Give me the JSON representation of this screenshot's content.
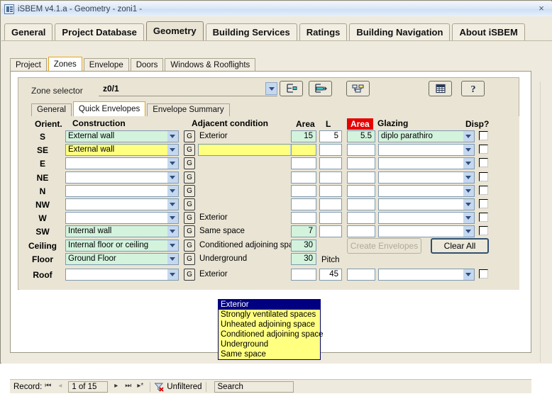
{
  "window": {
    "title": "iSBEM v4.1.a - Geometry - zoni1 -",
    "close_label": "×",
    "icon": "app-icon"
  },
  "main_tabs": [
    {
      "label": "General",
      "active": false
    },
    {
      "label": "Project Database",
      "active": false
    },
    {
      "label": "Geometry",
      "active": true
    },
    {
      "label": "Building Services",
      "active": false
    },
    {
      "label": "Ratings",
      "active": false
    },
    {
      "label": "Building Navigation",
      "active": false
    },
    {
      "label": "About iSBEM",
      "active": false
    }
  ],
  "sub_tabs": [
    {
      "label": "Project",
      "active": false
    },
    {
      "label": "Zones",
      "active": true
    },
    {
      "label": "Envelope",
      "active": false
    },
    {
      "label": "Doors",
      "active": false
    },
    {
      "label": "Windows & Rooflights",
      "active": false
    }
  ],
  "zone_selector": {
    "label": "Zone selector",
    "value": "z0/1"
  },
  "toolbar": {
    "buttons": [
      {
        "name": "collapse-tree-button",
        "icon": "tree-collapse-icon"
      },
      {
        "name": "expand-tree-button",
        "icon": "tree-expand-icon"
      },
      {
        "name": "duplicate-zone-button",
        "icon": "copy-icon"
      },
      {
        "name": "table-view-button",
        "icon": "grid-icon"
      },
      {
        "name": "help-button",
        "icon": "question-icon"
      }
    ]
  },
  "inner_tabs": [
    {
      "label": "General",
      "active": false
    },
    {
      "label": "Quick Envelopes",
      "active": true
    },
    {
      "label": "Envelope Summary",
      "active": false
    }
  ],
  "grid": {
    "headers": {
      "orient": "Orient.",
      "construction": "Construction",
      "adjacent": "Adjacent condition",
      "area": "Area",
      "length": "L",
      "area_glazed": "Area",
      "glazing": "Glazing",
      "disp": "Disp?"
    },
    "rows": [
      {
        "orient": "S",
        "construction": "External wall",
        "cstate": "green",
        "adjacent": "Exterior",
        "adj_open": false,
        "area": "15",
        "astate": "green",
        "len": "5",
        "area2": "5.5",
        "a2state": "green",
        "glazing": "diplo parathiro",
        "gstate": "green",
        "disp": false
      },
      {
        "orient": "SE",
        "construction": "External wall",
        "cstate": "yellow",
        "adjacent": "",
        "adj_open": true,
        "area": "",
        "astate": "yellow",
        "len": "",
        "area2": "",
        "a2state": "white",
        "glazing": "",
        "gstate": "white",
        "disp": false
      },
      {
        "orient": "E",
        "construction": "",
        "cstate": "white",
        "adjacent": "",
        "adj_open": false,
        "area": "",
        "astate": "white",
        "len": "",
        "area2": "",
        "a2state": "white",
        "glazing": "",
        "gstate": "white",
        "disp": false
      },
      {
        "orient": "NE",
        "construction": "",
        "cstate": "white",
        "adjacent": "",
        "adj_open": false,
        "area": "",
        "astate": "white",
        "len": "",
        "area2": "",
        "a2state": "white",
        "glazing": "",
        "gstate": "white",
        "disp": false
      },
      {
        "orient": "N",
        "construction": "",
        "cstate": "white",
        "adjacent": "",
        "adj_open": false,
        "area": "",
        "astate": "white",
        "len": "",
        "area2": "",
        "a2state": "white",
        "glazing": "",
        "gstate": "white",
        "disp": false
      },
      {
        "orient": "NW",
        "construction": "",
        "cstate": "white",
        "adjacent": "",
        "adj_open": false,
        "area": "",
        "astate": "white",
        "len": "",
        "area2": "",
        "a2state": "white",
        "glazing": "",
        "gstate": "white",
        "disp": false
      },
      {
        "orient": "W",
        "construction": "",
        "cstate": "white",
        "adjacent": "Exterior",
        "adj_open": false,
        "area": "",
        "astate": "white",
        "len": "",
        "area2": "",
        "a2state": "white",
        "glazing": "",
        "gstate": "white",
        "disp": false
      },
      {
        "orient": "SW",
        "construction": "Internal wall",
        "cstate": "green",
        "adjacent": "Same space",
        "adj_open": false,
        "area": "7",
        "astate": "green",
        "len": "",
        "area2": "",
        "a2state": "white",
        "glazing": "",
        "gstate": "white",
        "disp": false
      },
      {
        "orient": "Ceiling",
        "construction": "Internal floor or ceiling",
        "cstate": "green",
        "adjacent": "Conditioned adjoining spac",
        "adj_open": false,
        "area": "30",
        "astate": "green",
        "len": "",
        "area2": "",
        "a2state": "none",
        "glazing": "",
        "gstate": "none",
        "disp": null
      },
      {
        "orient": "Floor",
        "construction": "Ground Floor",
        "cstate": "green",
        "adjacent": "Underground",
        "adj_open": false,
        "area": "30",
        "astate": "green",
        "len": "",
        "area2": "",
        "a2state": "none",
        "glazing": "",
        "gstate": "none",
        "disp": null
      }
    ],
    "roof_row": {
      "orient": "Roof",
      "construction": "",
      "cstate": "white",
      "adjacent": "Exterior",
      "area": "",
      "pitch_label": "Pitch",
      "pitch": "45",
      "area2": "",
      "glazing": "",
      "disp": false
    }
  },
  "adjacent_dropdown": {
    "open": true,
    "selected_index": 0,
    "options": [
      "Exterior",
      "Strongly ventilated spaces",
      "Unheated adjoining space",
      "Conditioned adjoining space",
      "Underground",
      "Same space"
    ]
  },
  "actions": {
    "create_envelopes": "Create Envelopes",
    "clear_all": "Clear All"
  },
  "record_nav": {
    "label": "Record:",
    "first": "⏮",
    "prev": "◂",
    "position": "1 of 15",
    "next": "▸",
    "last": "⏭",
    "new": "▸*",
    "filter_status": "Unfiltered",
    "search_placeholder": "Search",
    "search_value": "Search"
  },
  "colors": {
    "accent_tab": "#e8a317",
    "area_header_bg": "#e60000",
    "focus_yellow": "#ffff80",
    "readonly_green": "#d3f3dd",
    "dropdown_select_bg": "#000080",
    "window_bg": "#efeade"
  }
}
